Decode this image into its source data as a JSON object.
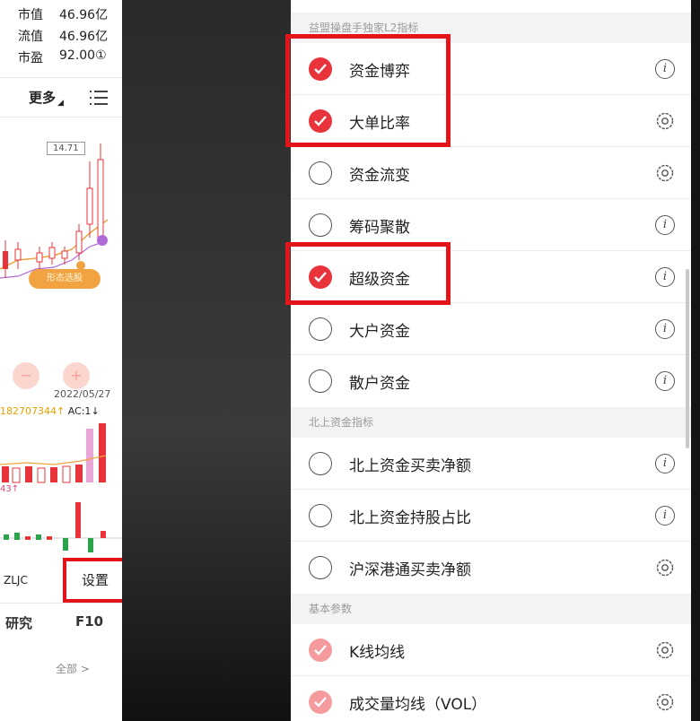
{
  "left_panel": {
    "stats": [
      {
        "label": "市值",
        "value": "46.96亿"
      },
      {
        "label": "流值",
        "value": "46.96亿"
      },
      {
        "label": "市盈",
        "value": "92.00①"
      }
    ],
    "more_label": "更多",
    "price_tag": "14.71",
    "state_label": "形态选股",
    "date": "2022/05/27",
    "volume_text": "182707344",
    "ac_text": "AC:1",
    "small_text": "43↑",
    "zljc_label": "ZLJC",
    "settings_label": "设置",
    "research_tab": "研究",
    "f10_tab": "F10",
    "all_link": "全部 >"
  },
  "right_panel": {
    "sections": [
      {
        "header": "益盟操盘手独家L2指标",
        "items": [
          {
            "label": "资金博弈",
            "checked": true,
            "trail_icon": "info-icon"
          },
          {
            "label": "大单比率",
            "checked": true,
            "trail_icon": "gear-icon"
          },
          {
            "label": "资金流变",
            "checked": false,
            "trail_icon": "gear-icon"
          },
          {
            "label": "筹码聚散",
            "checked": false,
            "trail_icon": "info-icon"
          },
          {
            "label": "超级资金",
            "checked": true,
            "trail_icon": "info-icon"
          },
          {
            "label": "大户资金",
            "checked": false,
            "trail_icon": "info-icon"
          },
          {
            "label": "散户资金",
            "checked": false,
            "trail_icon": "info-icon"
          }
        ]
      },
      {
        "header": "北上资金指标",
        "items": [
          {
            "label": "北上资金买卖净额",
            "checked": false,
            "trail_icon": "info-icon"
          },
          {
            "label": "北上资金持股占比",
            "checked": false,
            "trail_icon": "info-icon"
          },
          {
            "label": "沪深港通买卖净额",
            "checked": false,
            "trail_icon": "gear-icon"
          }
        ]
      },
      {
        "header": "基本参数",
        "items": [
          {
            "label": "K线均线",
            "checked": true,
            "trail_icon": "gear-icon"
          },
          {
            "label": "成交量均线（VOL）",
            "checked": true,
            "trail_icon": "gear-icon"
          }
        ]
      }
    ]
  },
  "colors": {
    "accent_red": "#e8333a",
    "highlight_red": "#e3151b",
    "faded_check": "#f59a9d",
    "section_bg": "#f3f3f3",
    "candle_red": "#e8333a",
    "candle_green": "#2aa34a",
    "ma_yellow": "#f2a341",
    "ma_purple": "#b06ad6"
  }
}
